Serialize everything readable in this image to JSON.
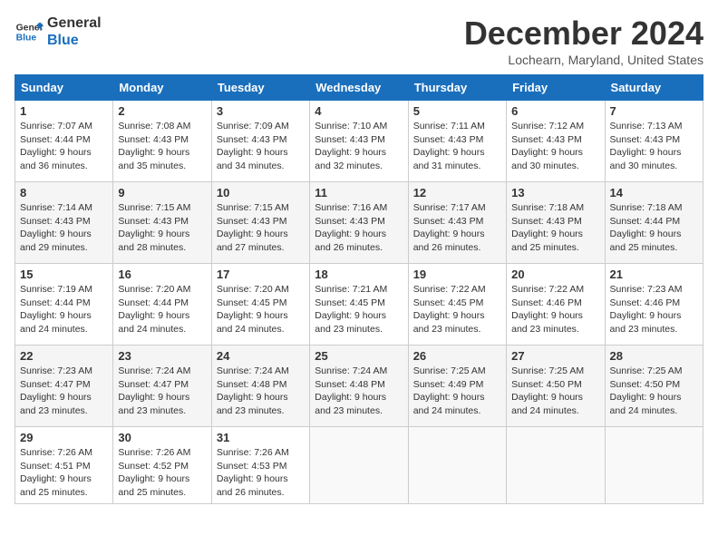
{
  "header": {
    "logo_line1": "General",
    "logo_line2": "Blue",
    "month_title": "December 2024",
    "location": "Lochearn, Maryland, United States"
  },
  "columns": [
    "Sunday",
    "Monday",
    "Tuesday",
    "Wednesday",
    "Thursday",
    "Friday",
    "Saturday"
  ],
  "weeks": [
    [
      {
        "day": "1",
        "sunrise": "Sunrise: 7:07 AM",
        "sunset": "Sunset: 4:44 PM",
        "daylight": "Daylight: 9 hours and 36 minutes."
      },
      {
        "day": "2",
        "sunrise": "Sunrise: 7:08 AM",
        "sunset": "Sunset: 4:43 PM",
        "daylight": "Daylight: 9 hours and 35 minutes."
      },
      {
        "day": "3",
        "sunrise": "Sunrise: 7:09 AM",
        "sunset": "Sunset: 4:43 PM",
        "daylight": "Daylight: 9 hours and 34 minutes."
      },
      {
        "day": "4",
        "sunrise": "Sunrise: 7:10 AM",
        "sunset": "Sunset: 4:43 PM",
        "daylight": "Daylight: 9 hours and 32 minutes."
      },
      {
        "day": "5",
        "sunrise": "Sunrise: 7:11 AM",
        "sunset": "Sunset: 4:43 PM",
        "daylight": "Daylight: 9 hours and 31 minutes."
      },
      {
        "day": "6",
        "sunrise": "Sunrise: 7:12 AM",
        "sunset": "Sunset: 4:43 PM",
        "daylight": "Daylight: 9 hours and 30 minutes."
      },
      {
        "day": "7",
        "sunrise": "Sunrise: 7:13 AM",
        "sunset": "Sunset: 4:43 PM",
        "daylight": "Daylight: 9 hours and 30 minutes."
      }
    ],
    [
      {
        "day": "8",
        "sunrise": "Sunrise: 7:14 AM",
        "sunset": "Sunset: 4:43 PM",
        "daylight": "Daylight: 9 hours and 29 minutes."
      },
      {
        "day": "9",
        "sunrise": "Sunrise: 7:15 AM",
        "sunset": "Sunset: 4:43 PM",
        "daylight": "Daylight: 9 hours and 28 minutes."
      },
      {
        "day": "10",
        "sunrise": "Sunrise: 7:15 AM",
        "sunset": "Sunset: 4:43 PM",
        "daylight": "Daylight: 9 hours and 27 minutes."
      },
      {
        "day": "11",
        "sunrise": "Sunrise: 7:16 AM",
        "sunset": "Sunset: 4:43 PM",
        "daylight": "Daylight: 9 hours and 26 minutes."
      },
      {
        "day": "12",
        "sunrise": "Sunrise: 7:17 AM",
        "sunset": "Sunset: 4:43 PM",
        "daylight": "Daylight: 9 hours and 26 minutes."
      },
      {
        "day": "13",
        "sunrise": "Sunrise: 7:18 AM",
        "sunset": "Sunset: 4:43 PM",
        "daylight": "Daylight: 9 hours and 25 minutes."
      },
      {
        "day": "14",
        "sunrise": "Sunrise: 7:18 AM",
        "sunset": "Sunset: 4:44 PM",
        "daylight": "Daylight: 9 hours and 25 minutes."
      }
    ],
    [
      {
        "day": "15",
        "sunrise": "Sunrise: 7:19 AM",
        "sunset": "Sunset: 4:44 PM",
        "daylight": "Daylight: 9 hours and 24 minutes."
      },
      {
        "day": "16",
        "sunrise": "Sunrise: 7:20 AM",
        "sunset": "Sunset: 4:44 PM",
        "daylight": "Daylight: 9 hours and 24 minutes."
      },
      {
        "day": "17",
        "sunrise": "Sunrise: 7:20 AM",
        "sunset": "Sunset: 4:45 PM",
        "daylight": "Daylight: 9 hours and 24 minutes."
      },
      {
        "day": "18",
        "sunrise": "Sunrise: 7:21 AM",
        "sunset": "Sunset: 4:45 PM",
        "daylight": "Daylight: 9 hours and 23 minutes."
      },
      {
        "day": "19",
        "sunrise": "Sunrise: 7:22 AM",
        "sunset": "Sunset: 4:45 PM",
        "daylight": "Daylight: 9 hours and 23 minutes."
      },
      {
        "day": "20",
        "sunrise": "Sunrise: 7:22 AM",
        "sunset": "Sunset: 4:46 PM",
        "daylight": "Daylight: 9 hours and 23 minutes."
      },
      {
        "day": "21",
        "sunrise": "Sunrise: 7:23 AM",
        "sunset": "Sunset: 4:46 PM",
        "daylight": "Daylight: 9 hours and 23 minutes."
      }
    ],
    [
      {
        "day": "22",
        "sunrise": "Sunrise: 7:23 AM",
        "sunset": "Sunset: 4:47 PM",
        "daylight": "Daylight: 9 hours and 23 minutes."
      },
      {
        "day": "23",
        "sunrise": "Sunrise: 7:24 AM",
        "sunset": "Sunset: 4:47 PM",
        "daylight": "Daylight: 9 hours and 23 minutes."
      },
      {
        "day": "24",
        "sunrise": "Sunrise: 7:24 AM",
        "sunset": "Sunset: 4:48 PM",
        "daylight": "Daylight: 9 hours and 23 minutes."
      },
      {
        "day": "25",
        "sunrise": "Sunrise: 7:24 AM",
        "sunset": "Sunset: 4:48 PM",
        "daylight": "Daylight: 9 hours and 23 minutes."
      },
      {
        "day": "26",
        "sunrise": "Sunrise: 7:25 AM",
        "sunset": "Sunset: 4:49 PM",
        "daylight": "Daylight: 9 hours and 24 minutes."
      },
      {
        "day": "27",
        "sunrise": "Sunrise: 7:25 AM",
        "sunset": "Sunset: 4:50 PM",
        "daylight": "Daylight: 9 hours and 24 minutes."
      },
      {
        "day": "28",
        "sunrise": "Sunrise: 7:25 AM",
        "sunset": "Sunset: 4:50 PM",
        "daylight": "Daylight: 9 hours and 24 minutes."
      }
    ],
    [
      {
        "day": "29",
        "sunrise": "Sunrise: 7:26 AM",
        "sunset": "Sunset: 4:51 PM",
        "daylight": "Daylight: 9 hours and 25 minutes."
      },
      {
        "day": "30",
        "sunrise": "Sunrise: 7:26 AM",
        "sunset": "Sunset: 4:52 PM",
        "daylight": "Daylight: 9 hours and 25 minutes."
      },
      {
        "day": "31",
        "sunrise": "Sunrise: 7:26 AM",
        "sunset": "Sunset: 4:53 PM",
        "daylight": "Daylight: 9 hours and 26 minutes."
      },
      null,
      null,
      null,
      null
    ]
  ]
}
